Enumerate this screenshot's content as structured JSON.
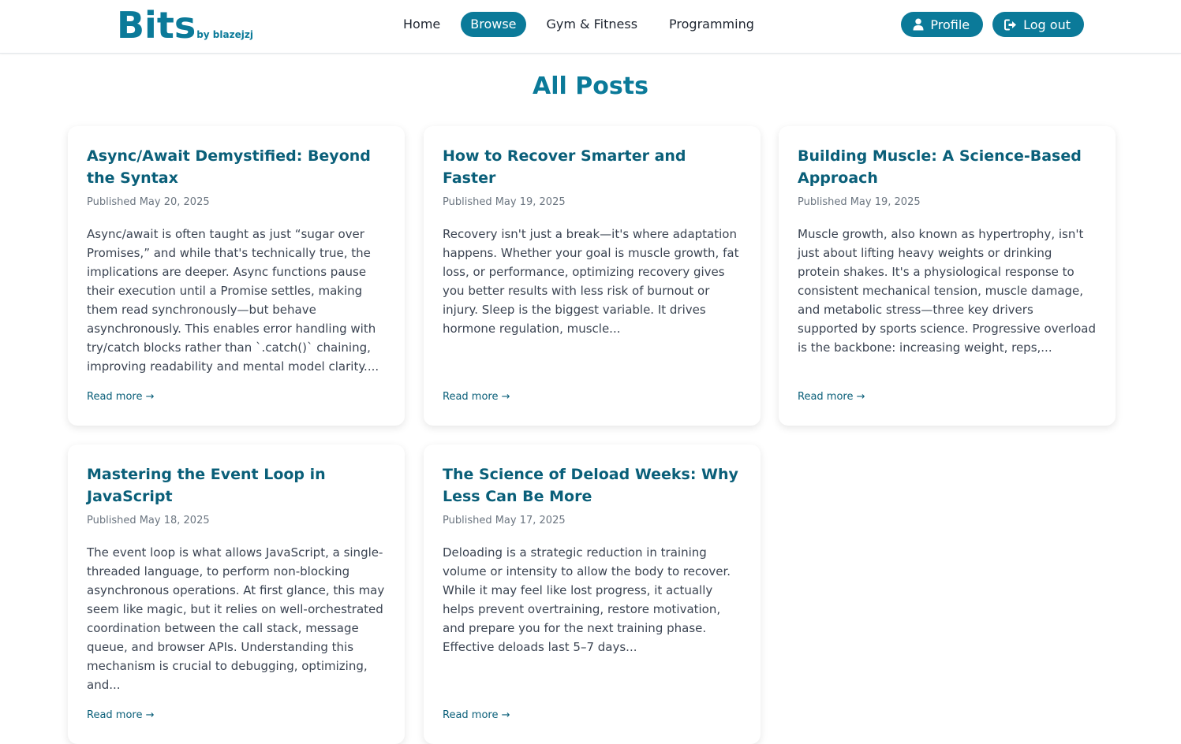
{
  "brand": {
    "name": "Bits",
    "byline": "by blazejzj"
  },
  "nav": {
    "items": [
      {
        "label": "Home"
      },
      {
        "label": "Browse"
      },
      {
        "label": "Gym & Fitness"
      },
      {
        "label": "Programming"
      }
    ]
  },
  "user_actions": {
    "profile_label": "Profile",
    "logout_label": "Log out"
  },
  "page_title": "All Posts",
  "read_more_label": "Read more →",
  "posts": [
    {
      "title": "Async/Await Demystified: Beyond the Syntax",
      "date": "Published May 20, 2025",
      "excerpt": "Async/await is often taught as just “sugar over Promises,” and while that's technically true, the implications are deeper. Async functions pause their execution until a Promise settles, making them read synchronously—but behave asynchronously. This enables error handling with try/catch blocks rather than `.catch()` chaining, improving readability and mental model clarity...."
    },
    {
      "title": "How to Recover Smarter and Faster",
      "date": "Published May 19, 2025",
      "excerpt": "Recovery isn't just a break—it's where adaptation happens. Whether your goal is muscle growth, fat loss, or performance, optimizing recovery gives you better results with less risk of burnout or injury. Sleep is the biggest variable. It drives hormone regulation, muscle..."
    },
    {
      "title": "Building Muscle: A Science-Based Approach",
      "date": "Published May 19, 2025",
      "excerpt": "Muscle growth, also known as hypertrophy, isn't just about lifting heavy weights or drinking protein shakes. It's a physiological response to consistent mechanical tension, muscle damage, and metabolic stress—three key drivers supported by sports science. Progressive overload is the backbone: increasing weight, reps,..."
    },
    {
      "title": "Mastering the Event Loop in JavaScript",
      "date": "Published May 18, 2025",
      "excerpt": "The event loop is what allows JavaScript, a single-threaded language, to perform non-blocking asynchronous operations. At first glance, this may seem like magic, but it relies on well-orchestrated coordination between the call stack, message queue, and browser APIs. Understanding this mechanism is crucial to debugging, optimizing, and..."
    },
    {
      "title": "The Science of Deload Weeks: Why Less Can Be More",
      "date": "Published May 17, 2025",
      "excerpt": "Deloading is a strategic reduction in training volume or intensity to allow the body to recover. While it may feel like lost progress, it actually helps prevent overtraining, restore motivation, and prepare you for the next training phase. Effective deloads last 5–7 days..."
    }
  ],
  "colors": {
    "accent": "#0b7a99",
    "title_text": "#0a5f79",
    "body_text": "#3b4452",
    "muted_text": "#6b7580"
  },
  "icons": {
    "profile": "user-icon",
    "logout": "logout-icon"
  }
}
